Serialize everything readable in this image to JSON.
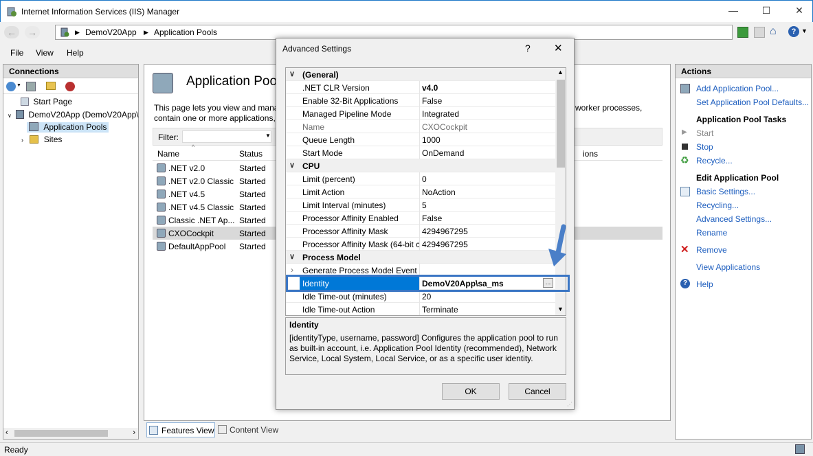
{
  "window": {
    "title": "Internet Information Services (IIS) Manager"
  },
  "address": {
    "segments": [
      "DemoV20App",
      "Application Pools"
    ]
  },
  "menu": [
    "File",
    "View",
    "Help"
  ],
  "connections": {
    "title": "Connections",
    "tree": [
      "Start Page",
      "DemoV20App (DemoV20App\\",
      "Application Pools",
      "Sites"
    ]
  },
  "center": {
    "title": "Application Pools",
    "desc1": "This page lets you view and mana",
    "desc2": "contain one or more applications,",
    "desc_right": "worker processes,",
    "filter_label": "Filter:",
    "columns": [
      "Name",
      "Status",
      "ions"
    ],
    "rows": [
      {
        "name": ".NET v2.0",
        "status": "Started"
      },
      {
        "name": ".NET v2.0 Classic",
        "status": "Started"
      },
      {
        "name": ".NET v4.5",
        "status": "Started"
      },
      {
        "name": ".NET v4.5 Classic",
        "status": "Started"
      },
      {
        "name": "Classic .NET Ap...",
        "status": "Started"
      },
      {
        "name": "CXOCockpit",
        "status": "Started"
      },
      {
        "name": "DefaultAppPool",
        "status": "Started"
      }
    ],
    "tabs": [
      "Features View",
      "Content View"
    ]
  },
  "actions": {
    "title": "Actions",
    "add": "Add Application Pool...",
    "defaults": "Set Application Pool Defaults...",
    "tasks_heading": "Application Pool Tasks",
    "start": "Start",
    "stop": "Stop",
    "recycle": "Recycle...",
    "edit_heading": "Edit Application Pool",
    "basic": "Basic Settings...",
    "recycling": "Recycling...",
    "advanced": "Advanced Settings...",
    "rename": "Rename",
    "remove": "Remove",
    "view_apps": "View Applications",
    "help": "Help"
  },
  "status": {
    "text": "Ready"
  },
  "dialog": {
    "title": "Advanced Settings",
    "help_glyph": "?",
    "close_glyph": "✕",
    "rows": [
      {
        "type": "cat",
        "k": "(General)"
      },
      {
        "k": ".NET CLR Version",
        "v": "v4.0",
        "bold": true
      },
      {
        "k": "Enable 32-Bit Applications",
        "v": "False"
      },
      {
        "k": "Managed Pipeline Mode",
        "v": "Integrated"
      },
      {
        "k": "Name",
        "v": "CXOCockpit",
        "gray": true
      },
      {
        "k": "Queue Length",
        "v": "1000"
      },
      {
        "k": "Start Mode",
        "v": "OnDemand"
      },
      {
        "type": "cat",
        "k": "CPU"
      },
      {
        "k": "Limit (percent)",
        "v": "0"
      },
      {
        "k": "Limit Action",
        "v": "NoAction"
      },
      {
        "k": "Limit Interval (minutes)",
        "v": "5"
      },
      {
        "k": "Processor Affinity Enabled",
        "v": "False"
      },
      {
        "k": "Processor Affinity Mask",
        "v": "4294967295"
      },
      {
        "k": "Processor Affinity Mask (64-bit c",
        "v": "4294967295"
      },
      {
        "type": "cat",
        "k": "Process Model"
      },
      {
        "k": "Generate Process Model Event L",
        "v": "",
        "expand": true
      },
      {
        "k": "Identity",
        "v": "DemoV20App\\sa_ms",
        "selected": true
      },
      {
        "k": "Idle Time-out (minutes)",
        "v": "20"
      },
      {
        "k": "Idle Time-out Action",
        "v": "Terminate"
      }
    ],
    "desc_title": "Identity",
    "desc_text": "[identityType, username, password] Configures the application pool to run as built-in account, i.e. Application Pool Identity (recommended), Network Service, Local System, Local Service, or as a specific user identity.",
    "ok": "OK",
    "cancel": "Cancel",
    "ellipsis": "..."
  }
}
